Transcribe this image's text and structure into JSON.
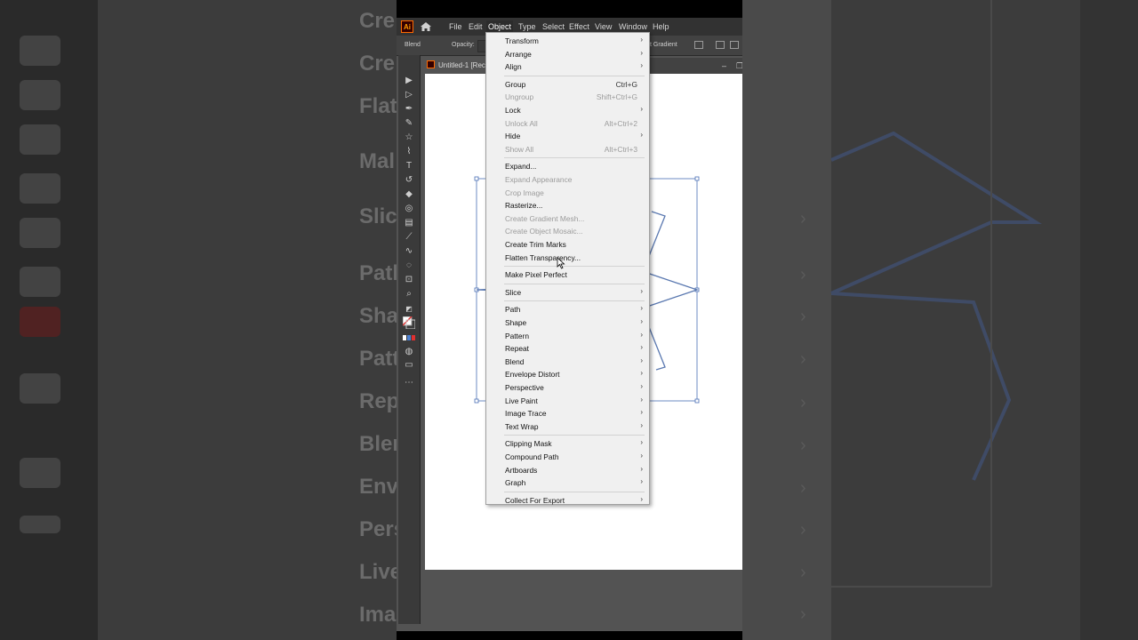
{
  "menubar": {
    "items": [
      "File",
      "Edit",
      "Object",
      "Type",
      "Select",
      "Effect",
      "View",
      "Window",
      "Help"
    ],
    "active": "Object",
    "logo": "Ai"
  },
  "controlbar": {
    "left_label": "Blend",
    "opacity_label": "Opacity:",
    "right_label": "t Gradient"
  },
  "document": {
    "tab_title": "Untitled-1 [Reco"
  },
  "object_menu": [
    {
      "label": "Transform",
      "submenu": true
    },
    {
      "label": "Arrange",
      "submenu": true
    },
    {
      "label": "Align",
      "submenu": true
    },
    {
      "sep": true
    },
    {
      "label": "Group",
      "shortcut": "Ctrl+G"
    },
    {
      "label": "Ungroup",
      "shortcut": "Shift+Ctrl+G",
      "disabled": true
    },
    {
      "label": "Lock",
      "submenu": true
    },
    {
      "label": "Unlock All",
      "shortcut": "Alt+Ctrl+2",
      "disabled": true
    },
    {
      "label": "Hide",
      "submenu": true
    },
    {
      "label": "Show All",
      "shortcut": "Alt+Ctrl+3",
      "disabled": true
    },
    {
      "sep": true
    },
    {
      "label": "Expand..."
    },
    {
      "label": "Expand Appearance",
      "disabled": true
    },
    {
      "label": "Crop Image",
      "disabled": true
    },
    {
      "label": "Rasterize..."
    },
    {
      "label": "Create Gradient Mesh...",
      "disabled": true
    },
    {
      "label": "Create Object Mosaic...",
      "disabled": true
    },
    {
      "label": "Create Trim Marks"
    },
    {
      "label": "Flatten Transparency..."
    },
    {
      "sep": true
    },
    {
      "label": "Make Pixel Perfect"
    },
    {
      "sep": true
    },
    {
      "label": "Slice",
      "submenu": true
    },
    {
      "sep": true
    },
    {
      "label": "Path",
      "submenu": true
    },
    {
      "label": "Shape",
      "submenu": true
    },
    {
      "label": "Pattern",
      "submenu": true
    },
    {
      "label": "Repeat",
      "submenu": true
    },
    {
      "label": "Blend",
      "submenu": true
    },
    {
      "label": "Envelope Distort",
      "submenu": true
    },
    {
      "label": "Perspective",
      "submenu": true
    },
    {
      "label": "Live Paint",
      "submenu": true
    },
    {
      "label": "Image Trace",
      "submenu": true
    },
    {
      "label": "Text Wrap",
      "submenu": true
    },
    {
      "sep": true
    },
    {
      "label": "Clipping Mask",
      "submenu": true
    },
    {
      "label": "Compound Path",
      "submenu": true
    },
    {
      "label": "Artboards",
      "submenu": true
    },
    {
      "label": "Graph",
      "submenu": true
    },
    {
      "sep": true
    },
    {
      "label": "Collect For Export",
      "submenu": true
    }
  ],
  "background_ghost": {
    "left_texts": [
      "Cre",
      "Cre",
      "Flat",
      "Mal",
      "Slic",
      "Path",
      "Sha",
      "Patt",
      "Rep",
      "Blen",
      "Env",
      "Pers",
      "Live",
      "Ima"
    ]
  },
  "colors": {
    "menubar_bg": "#323232",
    "menu_bg": "#f0f0f0",
    "disabled_text": "#9b9b9b",
    "selection_blue": "#4a6fb5"
  }
}
